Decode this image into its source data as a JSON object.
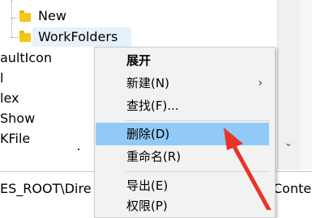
{
  "tree": {
    "items": [
      {
        "label": "New"
      },
      {
        "label": "WorkFolders"
      },
      {
        "label": "aultIcon"
      },
      {
        "label": "l"
      },
      {
        "label": "lex"
      },
      {
        "label": "Show"
      },
      {
        "label": "KFile"
      }
    ]
  },
  "statusbar": {
    "path_left": "ES_ROOT\\Dire",
    "path_right": "Conte"
  },
  "context_menu": {
    "items": [
      {
        "label": "展开"
      },
      {
        "label": "新建(N)",
        "submenu_arrow": "›"
      },
      {
        "label": "查找(F)..."
      },
      {
        "label": "删除(D)"
      },
      {
        "label": "重命名(R)"
      },
      {
        "label": "导出(E)"
      },
      {
        "label": "权限(P)"
      }
    ]
  },
  "colors": {
    "menu_highlight": "#91c9f7",
    "selected_row": "#e5f1fb",
    "folder": "#f5c518",
    "annotation_arrow": "#e8342a"
  },
  "scrollbar": {
    "down_arrow": "⌄"
  }
}
